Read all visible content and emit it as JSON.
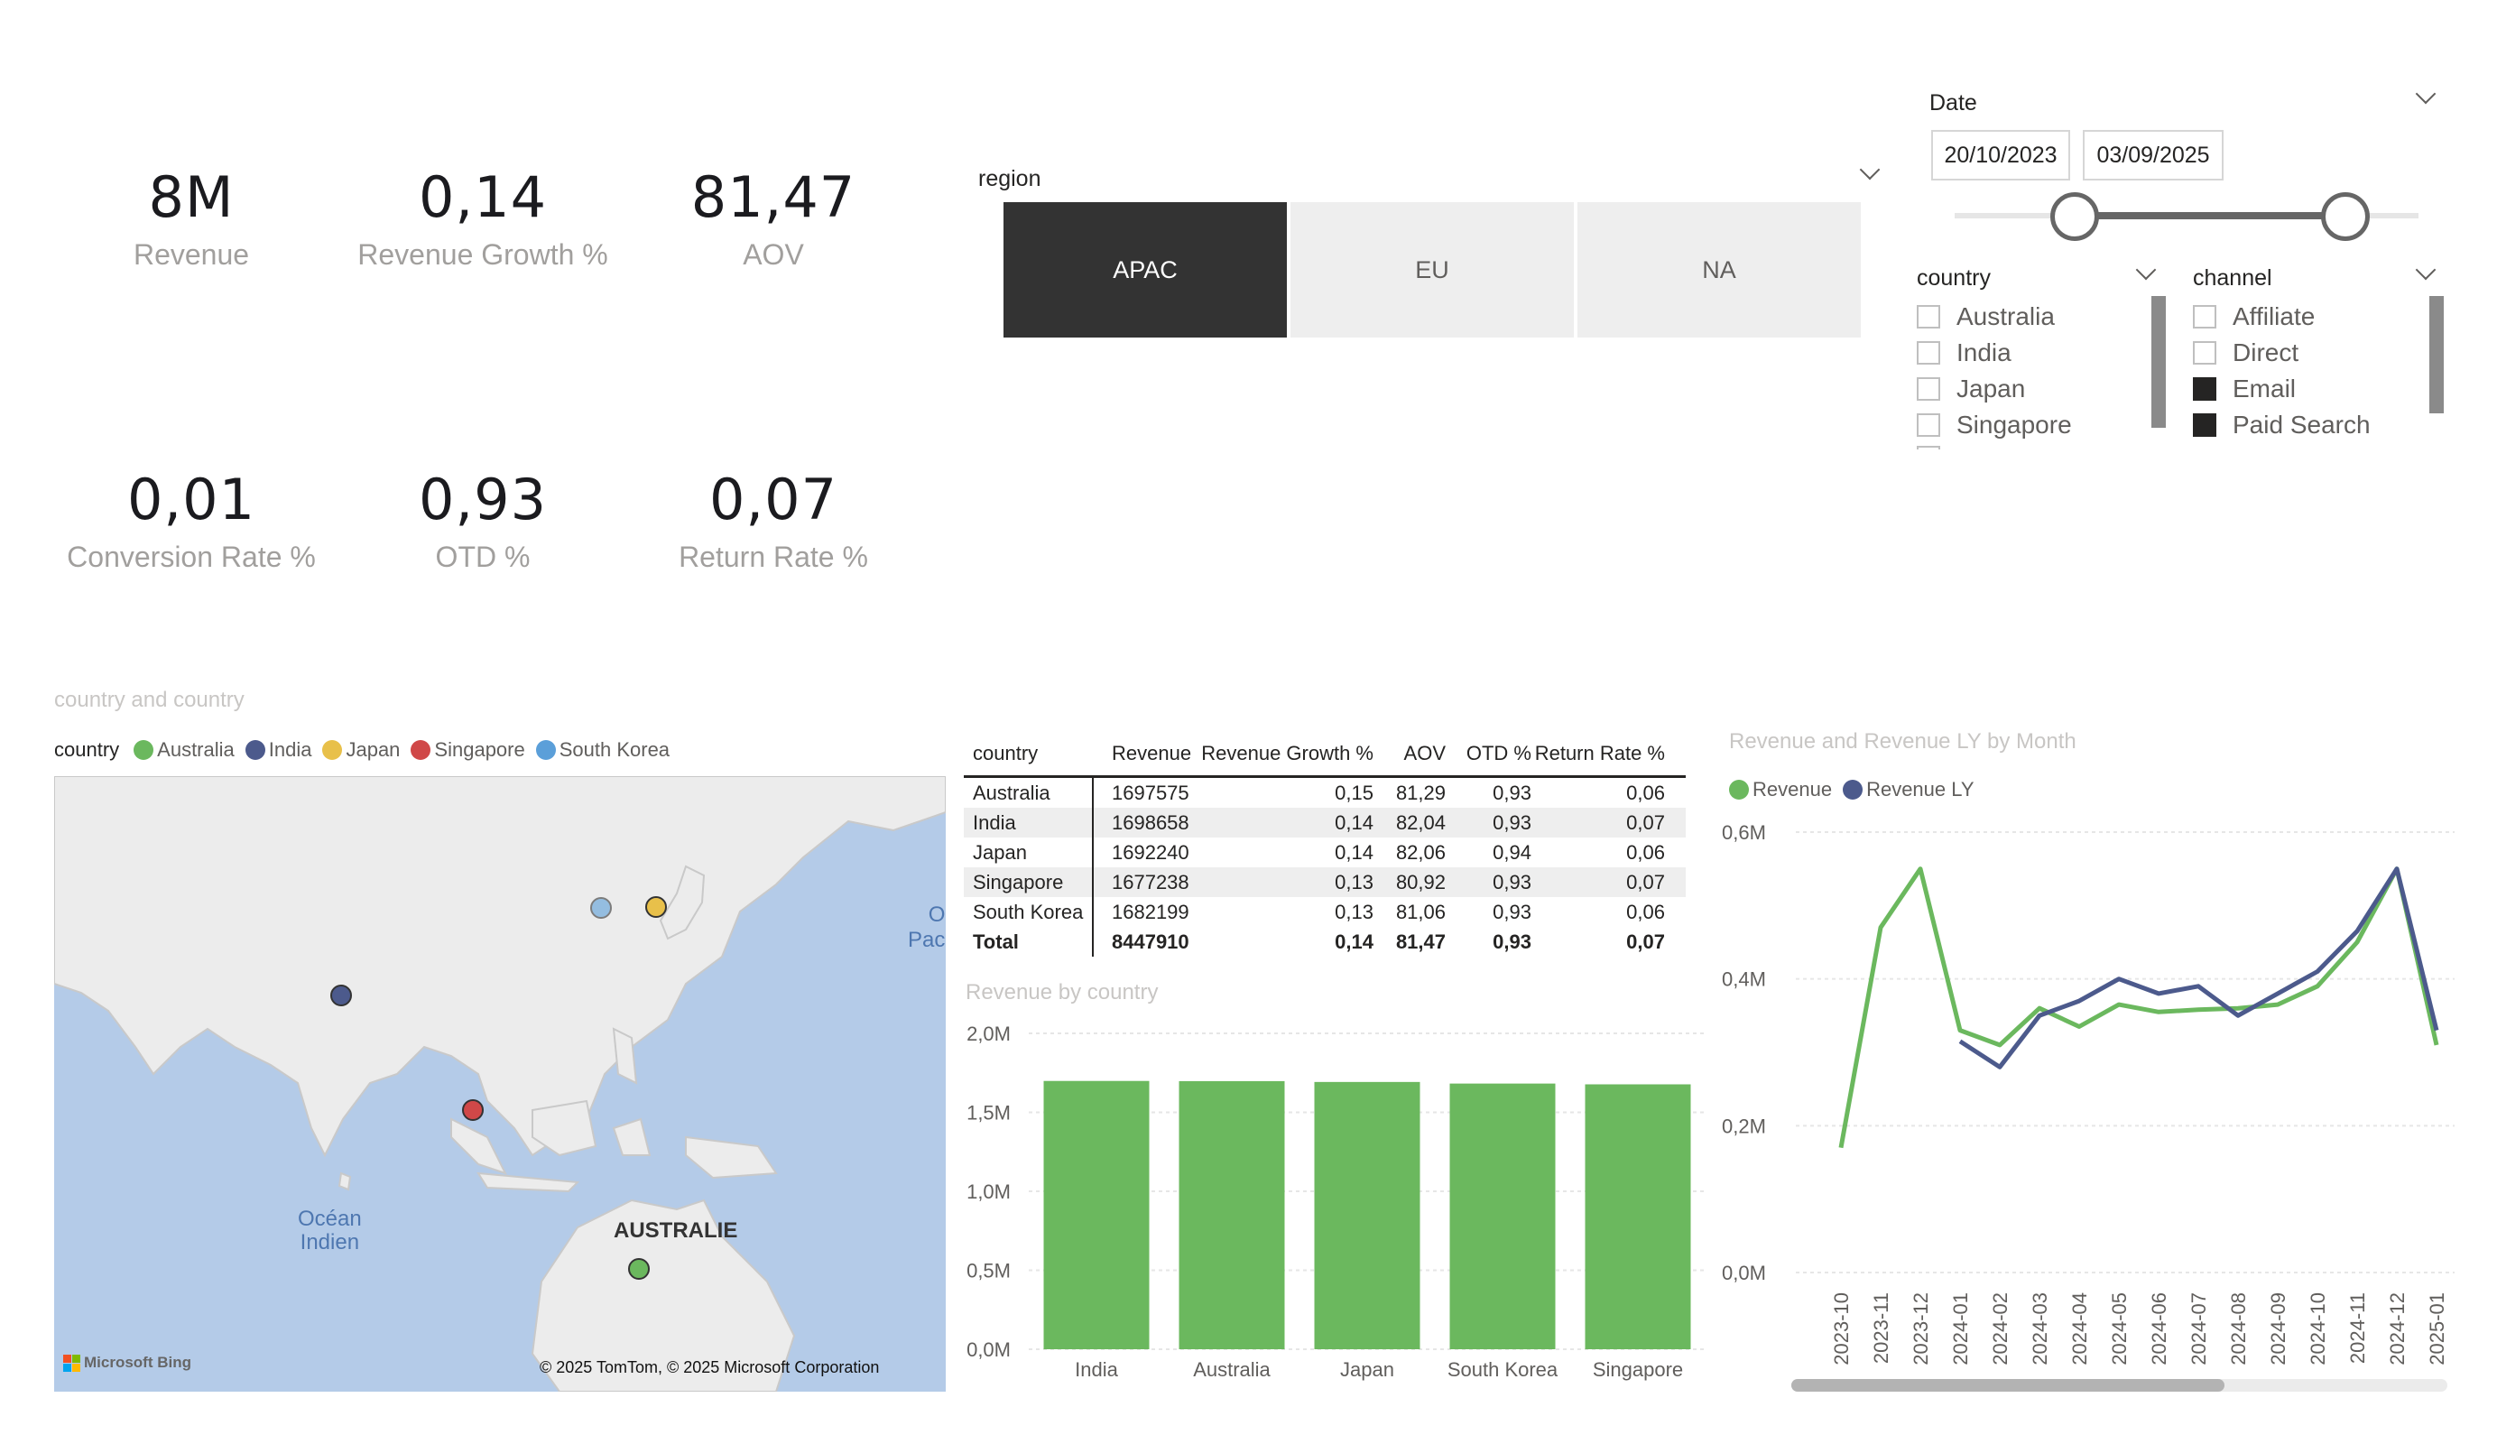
{
  "kpis": [
    {
      "value": "8M",
      "label": "Revenue"
    },
    {
      "value": "0,14",
      "label": "Revenue Growth %"
    },
    {
      "value": "81,47",
      "label": "AOV"
    },
    {
      "value": "0,01",
      "label": "Conversion Rate %"
    },
    {
      "value": "0,93",
      "label": "OTD %"
    },
    {
      "value": "0,07",
      "label": "Return Rate %"
    }
  ],
  "region_slicer": {
    "title": "region",
    "options": [
      {
        "label": "APAC",
        "selected": true
      },
      {
        "label": "EU",
        "selected": false
      },
      {
        "label": "NA",
        "selected": false
      }
    ]
  },
  "date_slicer": {
    "title": "Date",
    "start": "20/10/2023",
    "end": "03/09/2025"
  },
  "country_slicer": {
    "title": "country",
    "items": [
      {
        "label": "Australia",
        "checked": false
      },
      {
        "label": "India",
        "checked": false
      },
      {
        "label": "Japan",
        "checked": false
      },
      {
        "label": "Singapore",
        "checked": false
      }
    ]
  },
  "channel_slicer": {
    "title": "channel",
    "items": [
      {
        "label": "Affiliate",
        "checked": false
      },
      {
        "label": "Direct",
        "checked": false
      },
      {
        "label": "Email",
        "checked": true
      },
      {
        "label": "Paid Search",
        "checked": true
      }
    ]
  },
  "map": {
    "title": "country and country",
    "legend_title": "country",
    "legend": [
      {
        "label": "Australia",
        "color": "#6bb85e"
      },
      {
        "label": "India",
        "color": "#4c5a8c"
      },
      {
        "label": "Japan",
        "color": "#e8c04a"
      },
      {
        "label": "Singapore",
        "color": "#d04848"
      },
      {
        "label": "South Korea",
        "color": "#5b9fd9"
      }
    ],
    "labels": {
      "ocean": "Océan\nIndien",
      "ocean_line1": "Océan",
      "ocean_line2": "Indien",
      "australia": "AUSTRALIE",
      "pacific_1": "O",
      "pacific_2": "Pac"
    },
    "bing": "Microsoft Bing",
    "copyright": "© 2025 TomTom, © 2025 Microsoft Corporation"
  },
  "table": {
    "headers": [
      "country",
      "Revenue",
      "Revenue Growth %",
      "AOV",
      "OTD %",
      "Return Rate %"
    ],
    "rows": [
      [
        "Australia",
        "1697575",
        "0,15",
        "81,29",
        "0,93",
        "0,06"
      ],
      [
        "India",
        "1698658",
        "0,14",
        "82,04",
        "0,93",
        "0,07"
      ],
      [
        "Japan",
        "1692240",
        "0,14",
        "82,06",
        "0,94",
        "0,06"
      ],
      [
        "Singapore",
        "1677238",
        "0,13",
        "80,92",
        "0,93",
        "0,07"
      ],
      [
        "South Korea",
        "1682199",
        "0,13",
        "81,06",
        "0,93",
        "0,06"
      ]
    ],
    "total": [
      "Total",
      "8447910",
      "0,14",
      "81,47",
      "0,93",
      "0,07"
    ]
  },
  "chart_data": [
    {
      "type": "bar",
      "title": "Revenue by country",
      "categories": [
        "India",
        "Australia",
        "Japan",
        "South Korea",
        "Singapore"
      ],
      "values": [
        1698658,
        1697575,
        1692240,
        1682199,
        1677238
      ],
      "ylim": [
        0,
        2000000
      ],
      "yticks": [
        "0,0M",
        "0,5M",
        "1,0M",
        "1,5M",
        "2,0M"
      ],
      "color": "#6bb85e",
      "grid": true
    },
    {
      "type": "line",
      "title": "Revenue and Revenue LY by Month",
      "categories": [
        "2023-10",
        "2023-11",
        "2023-12",
        "2024-01",
        "2024-02",
        "2024-03",
        "2024-04",
        "2024-05",
        "2024-06",
        "2024-07",
        "2024-08",
        "2024-09",
        "2024-10",
        "2024-11",
        "2024-12",
        "2025-01"
      ],
      "series": [
        {
          "name": "Revenue",
          "color": "#6bb85e",
          "values": [
            0.17,
            0.47,
            0.55,
            0.33,
            0.31,
            0.36,
            0.335,
            0.365,
            0.355,
            0.358,
            0.36,
            0.365,
            0.39,
            0.45,
            0.55,
            0.31
          ]
        },
        {
          "name": "Revenue LY",
          "color": "#4c5a8c",
          "values": [
            null,
            null,
            null,
            0.315,
            0.28,
            0.35,
            0.37,
            0.4,
            0.38,
            0.39,
            0.35,
            0.38,
            0.41,
            0.465,
            0.55,
            0.33
          ]
        }
      ],
      "ylim": [
        0,
        0.6
      ],
      "yticks": [
        "0,0M",
        "0,2M",
        "0,4M",
        "0,6M"
      ],
      "legend_position": "top-left",
      "grid": true
    }
  ]
}
